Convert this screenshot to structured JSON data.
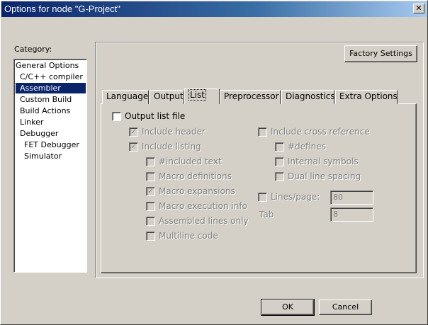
{
  "window": {
    "title": "Options for node \"G-Project\"",
    "close_glyph": "✕"
  },
  "category": {
    "label": "Category:",
    "items": [
      {
        "label": "General Options",
        "indent": 0,
        "selected": false
      },
      {
        "label": "C/C++ compiler",
        "indent": 1,
        "selected": false
      },
      {
        "label": "Assembler",
        "indent": 1,
        "selected": true
      },
      {
        "label": "Custom Build",
        "indent": 1,
        "selected": false
      },
      {
        "label": "Build Actions",
        "indent": 1,
        "selected": false
      },
      {
        "label": "Linker",
        "indent": 1,
        "selected": false
      },
      {
        "label": "Debugger",
        "indent": 1,
        "selected": false
      },
      {
        "label": "FET Debugger",
        "indent": 2,
        "selected": false
      },
      {
        "label": "Simulator",
        "indent": 2,
        "selected": false
      }
    ]
  },
  "factory_settings_label": "Factory Settings",
  "tabs": [
    "Language",
    "Output",
    "List",
    "Preprocessor",
    "Diagnostics",
    "Extra Options"
  ],
  "active_tab": "List",
  "list_page": {
    "output_list_file": {
      "label": "Output list file",
      "checked": false
    },
    "include_header": {
      "label": "Include header",
      "checked": true
    },
    "include_listing": {
      "label": "Include listing",
      "checked": true
    },
    "included_text": {
      "label": "#included text",
      "checked": false
    },
    "macro_definitions": {
      "label": "Macro definitions",
      "checked": false
    },
    "macro_expansions": {
      "label": "Macro expansions",
      "checked": true
    },
    "macro_execution_info": {
      "label": "Macro execution info",
      "checked": false
    },
    "assembled_lines_only": {
      "label": "Assembled lines only",
      "checked": false
    },
    "multiline_code": {
      "label": "Multiline code",
      "checked": false
    },
    "include_cross_reference": {
      "label": "Include cross reference",
      "checked": false
    },
    "defines": {
      "label": "#defines",
      "checked": false
    },
    "internal_symbols": {
      "label": "Internal symbols",
      "checked": false
    },
    "dual_line_spacing": {
      "label": "Dual line spacing",
      "checked": false
    },
    "lines_page": {
      "label": "Lines/page:",
      "checked": false,
      "value": "80"
    },
    "tab": {
      "label": "Tab",
      "value": "8"
    }
  },
  "buttons": {
    "ok": "OK",
    "cancel": "Cancel"
  },
  "check_glyph": "✓"
}
